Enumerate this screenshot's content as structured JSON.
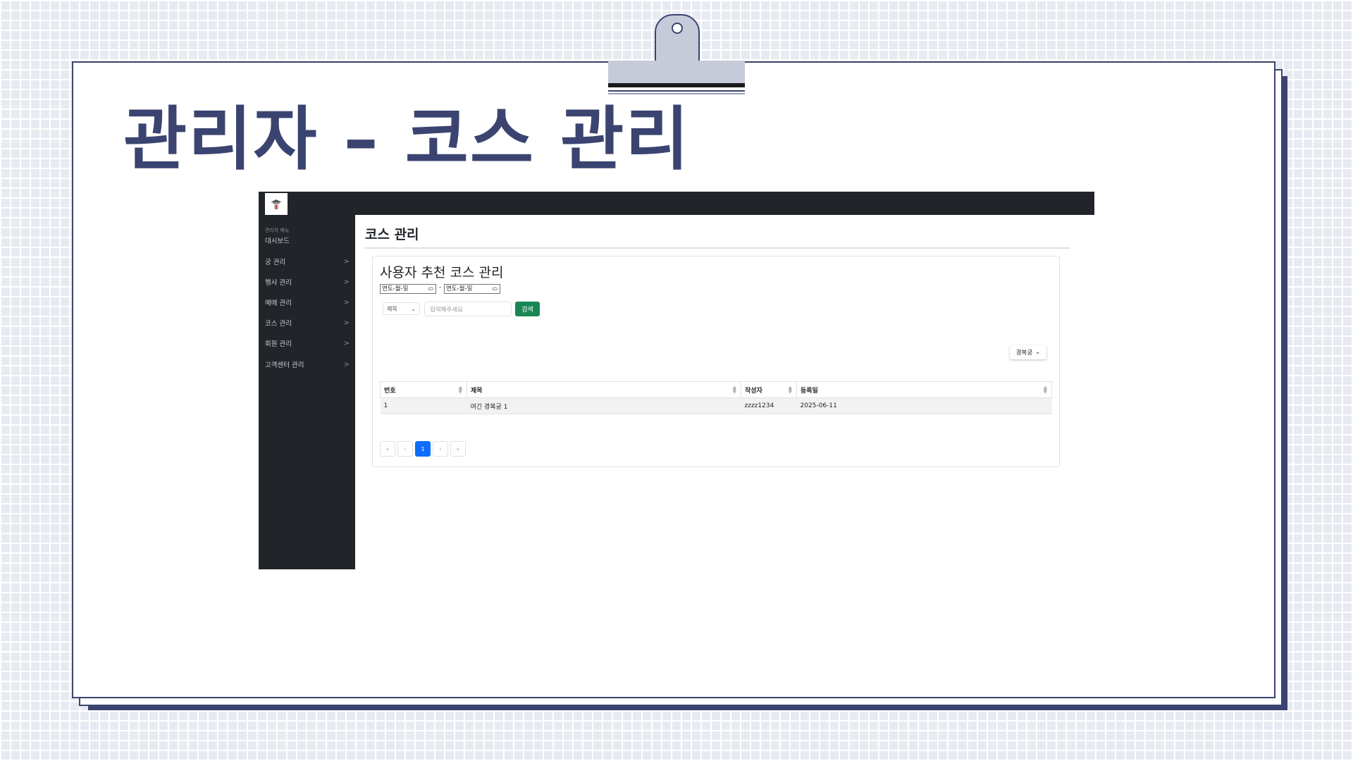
{
  "slide": {
    "title": "관리자 – 코스 관리"
  },
  "app": {
    "sidebar": {
      "heading": "관리자 메뉴",
      "items": [
        {
          "label": "대시보드",
          "chevron": ""
        },
        {
          "label": "궁 관리",
          "chevron": ">"
        },
        {
          "label": "행사 관리",
          "chevron": ">"
        },
        {
          "label": "예매 관리",
          "chevron": ">"
        },
        {
          "label": "코스 관리",
          "chevron": ">"
        },
        {
          "label": "회원 관리",
          "chevron": ">"
        },
        {
          "label": "고객센터 관리",
          "chevron": ">"
        }
      ]
    },
    "main": {
      "title": "코스 관리",
      "panel": {
        "title": "사용자 추천 코스 관리",
        "date_from": "연도-월-일",
        "date_separator": "-",
        "date_to": "연도-월-일",
        "search_field_select": "제목",
        "search_placeholder": "입력해주세요",
        "search_button": "검색",
        "palace_filter": "경복궁",
        "table": {
          "columns": [
            "번호",
            "제목",
            "작성자",
            "등록일"
          ],
          "rows": [
            [
              "1",
              "여긴 경복궁 1",
              "zzzz1234",
              "2025-06-11"
            ]
          ]
        },
        "pagination": {
          "first": "«",
          "prev": "‹",
          "current": "1",
          "next": "›",
          "last": "»"
        }
      }
    }
  },
  "colors": {
    "accent_navy": "#3b4470",
    "sidebar_bg": "#212529",
    "search_button": "#198754",
    "active_page": "#0d6efd"
  }
}
